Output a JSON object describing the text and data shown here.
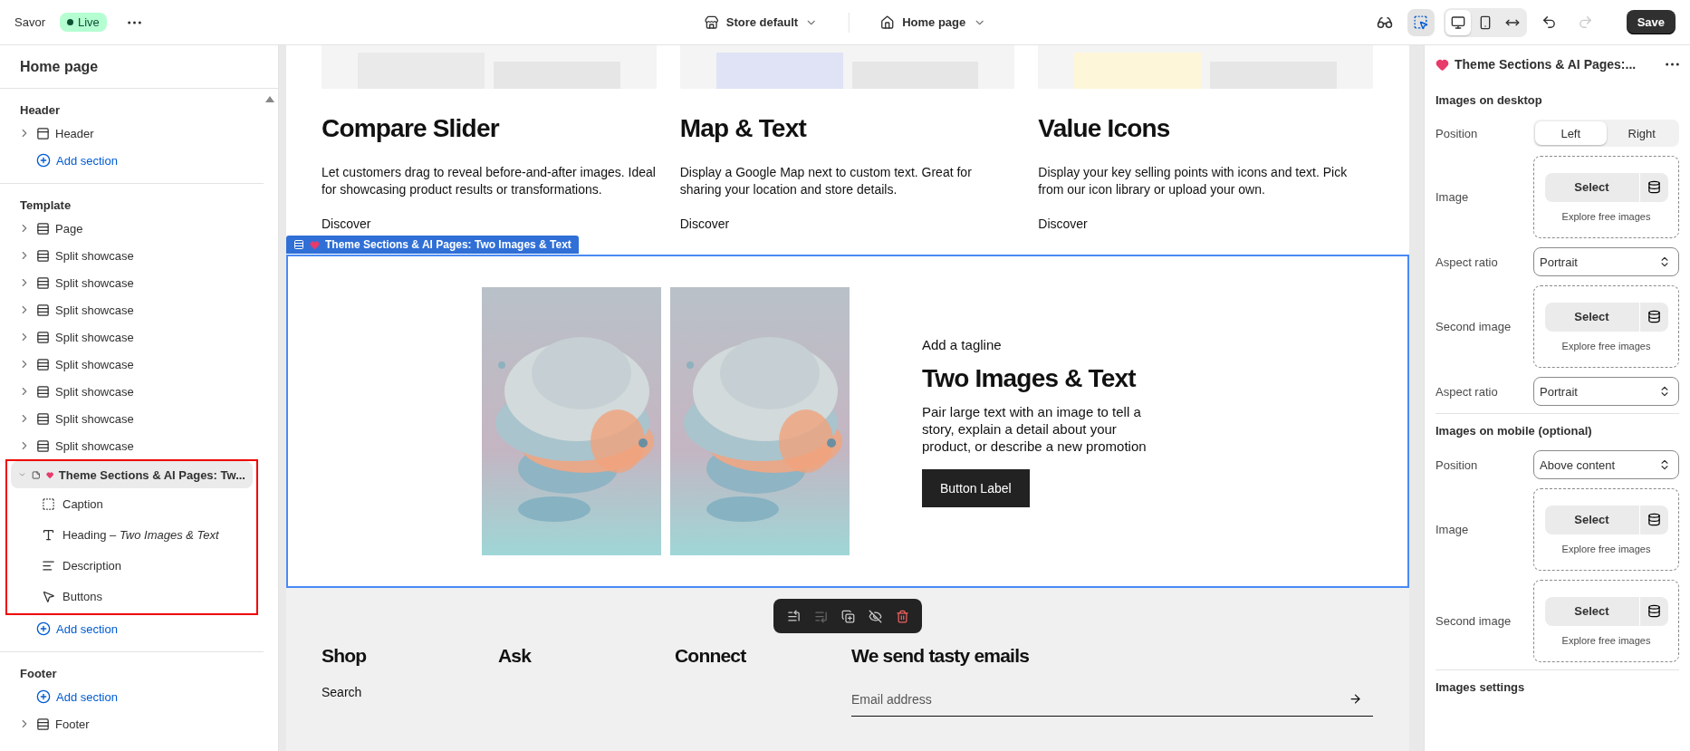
{
  "topbar": {
    "store_name": "Savor",
    "status": "Live",
    "store_selector": "Store default",
    "page_selector": "Home page",
    "inspector": {
      "selected": true
    },
    "devices": [
      {
        "kind": "desktop",
        "selected": true
      },
      {
        "kind": "mobile",
        "selected": false
      },
      {
        "kind": "full-width",
        "selected": false
      }
    ],
    "redo": {
      "disabled": true
    },
    "save": "Save"
  },
  "sidebar": {
    "title": "Home page",
    "groups": [
      {
        "title": "Header",
        "rows": [
          {
            "kind": "header",
            "label": "Header",
            "expanded": false,
            "highlighted": false
          },
          {
            "kind": "add",
            "label": "Add section"
          }
        ]
      },
      {
        "title": "Template",
        "rows": [
          {
            "kind": "section",
            "label": "Page",
            "expanded": false,
            "highlighted": false
          },
          {
            "kind": "section",
            "label": "Split showcase",
            "expanded": false,
            "highlighted": false
          },
          {
            "kind": "section",
            "label": "Split showcase",
            "expanded": false,
            "highlighted": false
          },
          {
            "kind": "section",
            "label": "Split showcase",
            "expanded": false,
            "highlighted": false
          },
          {
            "kind": "section",
            "label": "Split showcase",
            "expanded": false,
            "highlighted": false
          },
          {
            "kind": "section",
            "label": "Split showcase",
            "expanded": false,
            "highlighted": false
          },
          {
            "kind": "section",
            "label": "Split showcase",
            "expanded": false,
            "highlighted": false
          },
          {
            "kind": "section",
            "label": "Split showcase",
            "expanded": false,
            "highlighted": false
          },
          {
            "kind": "section",
            "label": "Split showcase",
            "expanded": false,
            "highlighted": false
          },
          {
            "kind": "app",
            "label": "Theme Sections & AI Pages: Tw...",
            "expanded": true,
            "highlighted": true,
            "selected": true,
            "children": [
              {
                "kind": "caption",
                "label": "Caption"
              },
              {
                "kind": "heading",
                "label": "Heading – *Two Images & Text*"
              },
              {
                "kind": "description",
                "label": "Description"
              },
              {
                "kind": "buttons",
                "label": "Buttons"
              }
            ]
          },
          {
            "kind": "add",
            "label": "Add section"
          }
        ]
      },
      {
        "title": "Footer",
        "rows": [
          {
            "kind": "add",
            "label": "Add section"
          },
          {
            "kind": "section",
            "label": "Footer",
            "expanded": false,
            "highlighted": false
          }
        ]
      }
    ]
  },
  "canvas": {
    "cards": [
      {
        "title": "Compare Slider",
        "text": "Let customers drag to reveal before-and-after images. Ideal for showcasing product results or transformations.",
        "link": "Discover"
      },
      {
        "title": "Map & Text",
        "text": "Display a Google Map next to custom text. Great for sharing your location and store details.",
        "link": "Discover"
      },
      {
        "title": "Value Icons",
        "text": "Display your key selling points with icons and text. Pick from our icon library or upload your own.",
        "link": "Discover"
      }
    ],
    "selected_section": {
      "label": "Theme Sections & AI Pages: Two Images & Text",
      "tagline": "Add a tagline",
      "heading": "Two Images & Text",
      "body": "Pair large text with an image to tell a story, explain a detail about your product, or describe a new promotion",
      "button": "Button Label"
    },
    "section_toolbar": [
      {
        "kind": "move-up",
        "disabled": false
      },
      {
        "kind": "move-down",
        "disabled": true
      },
      {
        "kind": "duplicate",
        "disabled": false
      },
      {
        "kind": "hide",
        "disabled": false
      },
      {
        "kind": "delete",
        "disabled": false
      }
    ],
    "footer": {
      "columns": [
        {
          "title": "Shop",
          "links": [
            "Search"
          ]
        },
        {
          "title": "Ask"
        },
        {
          "title": "Connect"
        }
      ],
      "newsletter": {
        "title": "We send tasty emails",
        "placeholder": "Email address"
      }
    }
  },
  "settings": {
    "title": "Theme Sections & AI Pages:...",
    "groups": [
      {
        "title": "Images on desktop",
        "fields": [
          {
            "kind": "segmented",
            "label": "Position",
            "options": [
              {
                "label": "Left",
                "selected": true
              },
              {
                "label": "Right",
                "selected": false
              }
            ]
          },
          {
            "label": "Image",
            "button": "Select",
            "link": "Explore free images"
          },
          {
            "kind": "select",
            "label": "Aspect ratio",
            "value": "Portrait"
          },
          {
            "label": "Second image",
            "button": "Select",
            "link": "Explore free images"
          },
          {
            "kind": "select",
            "label": "Aspect ratio",
            "value": "Portrait"
          }
        ]
      },
      {
        "title": "Images on mobile (optional)",
        "fields": [
          {
            "kind": "select",
            "label": "Position",
            "value": "Above content"
          },
          {
            "label": "Image",
            "button": "Select",
            "link": "Explore free images"
          },
          {
            "label": "Second image",
            "button": "Select",
            "link": "Explore free images"
          }
        ]
      },
      {
        "title": "Images settings"
      }
    ]
  }
}
